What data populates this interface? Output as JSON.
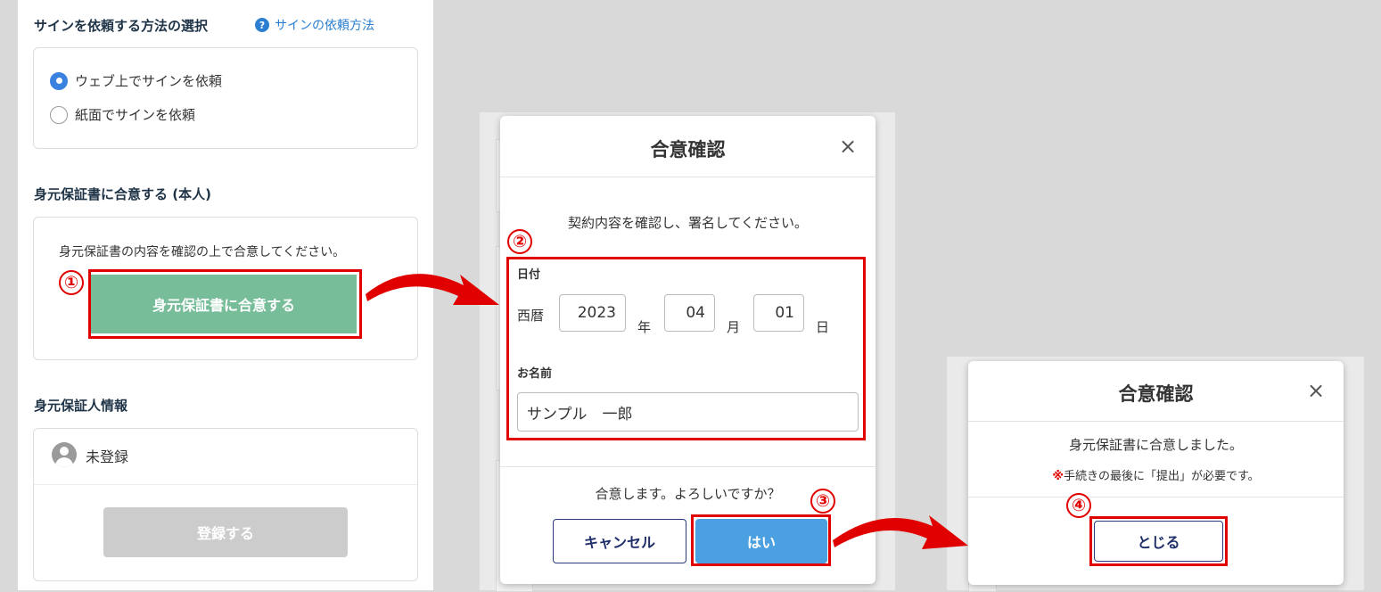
{
  "left": {
    "sign_method": {
      "title": "サインを依頼する方法の選択",
      "help_icon": "?",
      "help_link": "サインの依頼方法",
      "options": [
        {
          "label": "ウェブ上でサインを依頼",
          "selected": true
        },
        {
          "label": "紙面でサインを依頼",
          "selected": false
        }
      ]
    },
    "agree": {
      "title": "身元保証書に合意する (本人)",
      "message": "身元保証書の内容を確認の上で合意してください。",
      "button": "身元保証書に合意する"
    },
    "guarantor": {
      "title": "身元保証人情報",
      "status": "未登録",
      "register_button": "登録する"
    }
  },
  "modal1": {
    "title": "合意確認",
    "close": "×",
    "instruction": "契約内容を確認し、署名してください。",
    "date_label": "日付",
    "era": "西暦",
    "year": "2023",
    "year_unit": "年",
    "month": "04",
    "month_unit": "月",
    "day": "01",
    "day_unit": "日",
    "name_label": "お名前",
    "name_value": "サンプル　一郎",
    "question": "合意します。よろしいですか？",
    "cancel": "キャンセル",
    "yes": "はい"
  },
  "modal2": {
    "title": "合意確認",
    "close": "×",
    "message": "身元保証書に合意しました。",
    "note_mark": "※",
    "note": "手続きの最後に「提出」が必要です。",
    "close_button": "とじる"
  },
  "steps": [
    "①",
    "②",
    "③",
    "④"
  ],
  "colors": {
    "highlight_red": "#e00000",
    "agree_green": "#78bd9a",
    "yes_blue": "#4aa0e0",
    "link_blue": "#2a7fd0"
  }
}
